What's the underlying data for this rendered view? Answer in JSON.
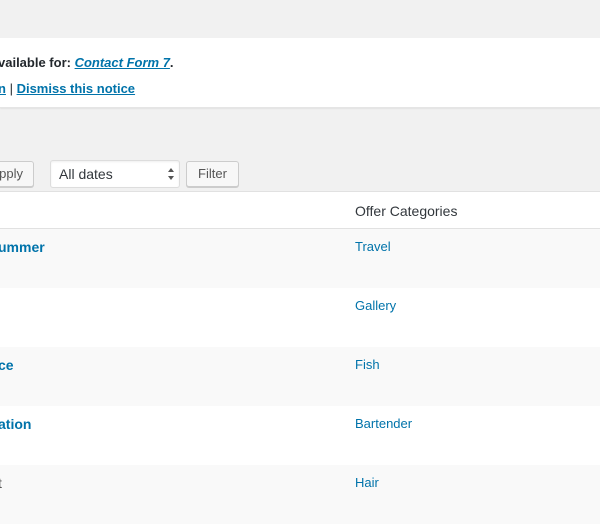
{
  "notice": {
    "text_prefix": "vailable for: ",
    "plugin_link": "Contact Form 7",
    "text_suffix": ".",
    "action_partial": "n",
    "separator": " | ",
    "dismiss_link": "Dismiss this notice"
  },
  "toolbar": {
    "apply_label": "pply",
    "date_filter_value": "All dates",
    "filter_label": "Filter"
  },
  "table": {
    "column_header": "Offer Categories",
    "rows": [
      {
        "title": "ummer",
        "category": "Travel"
      },
      {
        "title": "",
        "category": "Gallery"
      },
      {
        "title": "ce",
        "category": "Fish"
      },
      {
        "title": "ation",
        "category": "Bartender"
      },
      {
        "title": "t",
        "category": "Hair"
      }
    ]
  },
  "colors": {
    "link": "#0073aa",
    "background": "#f1f1f1",
    "stripe": "#f9f9f9"
  }
}
